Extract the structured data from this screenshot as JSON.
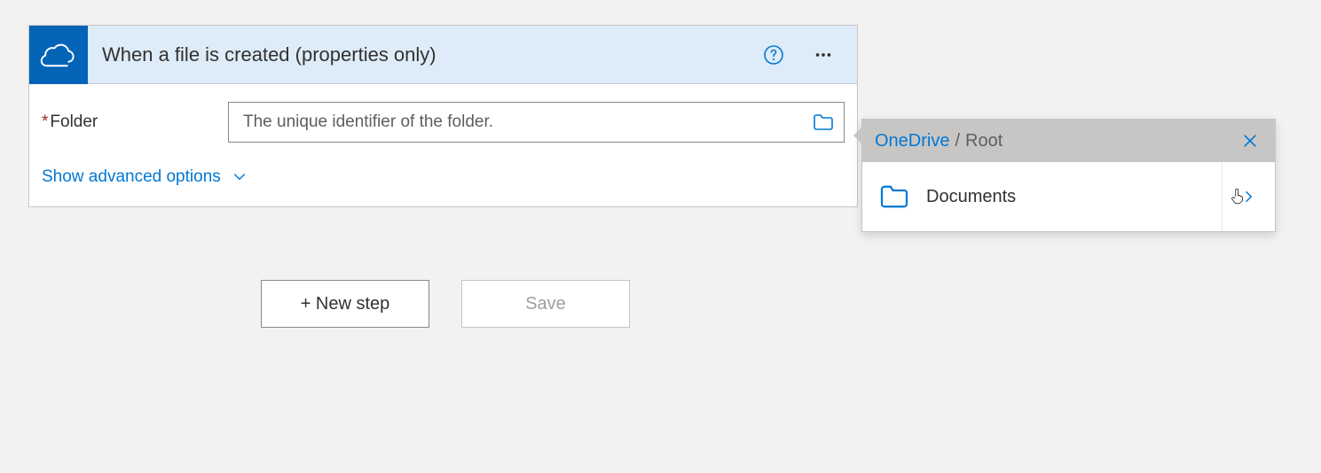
{
  "trigger": {
    "title": "When a file is created (properties only)",
    "field_label": "Folder",
    "placeholder": "The unique identifier of the folder.",
    "adv_label": "Show advanced options"
  },
  "actions": {
    "new_step": "+ New step",
    "save": "Save"
  },
  "picker": {
    "root_text": "OneDrive",
    "sep": "/",
    "current": "Root",
    "items": [
      {
        "label": "Documents"
      }
    ]
  }
}
